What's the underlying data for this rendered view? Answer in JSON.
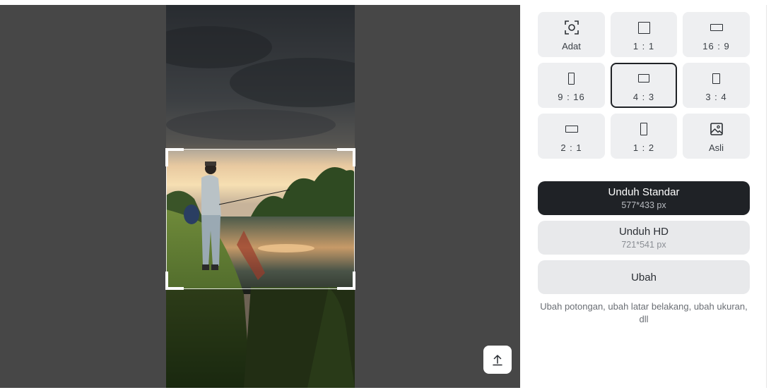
{
  "ratios": [
    {
      "label": "Adat",
      "icon": "custom-crop-icon"
    },
    {
      "label": "1 : 1",
      "icon": "square-icon"
    },
    {
      "label": "16 : 9",
      "icon": "wide-rect-icon"
    },
    {
      "label": "9 : 16",
      "icon": "tall-rect-icon"
    },
    {
      "label": "4 : 3",
      "icon": "landscape-rect-icon"
    },
    {
      "label": "3 : 4",
      "icon": "portrait-rect-icon"
    },
    {
      "label": "2 : 1",
      "icon": "wide-rect-icon"
    },
    {
      "label": "1 : 2",
      "icon": "tall-rect-icon"
    },
    {
      "label": "Asli",
      "icon": "image-icon"
    }
  ],
  "selected_ratio": "4 : 3",
  "download_standard": {
    "label": "Unduh Standar",
    "size": "577*433 px"
  },
  "download_hd": {
    "label": "Unduh HD",
    "size": "721*541 px"
  },
  "edit_button": {
    "label": "Ubah"
  },
  "hint": "Ubah potongan, ubah latar belakang, ubah ukuran, dll",
  "colors": {
    "editor_bg": "#474747",
    "primary_button": "#1f2226",
    "secondary_button": "#e8e9eb"
  }
}
